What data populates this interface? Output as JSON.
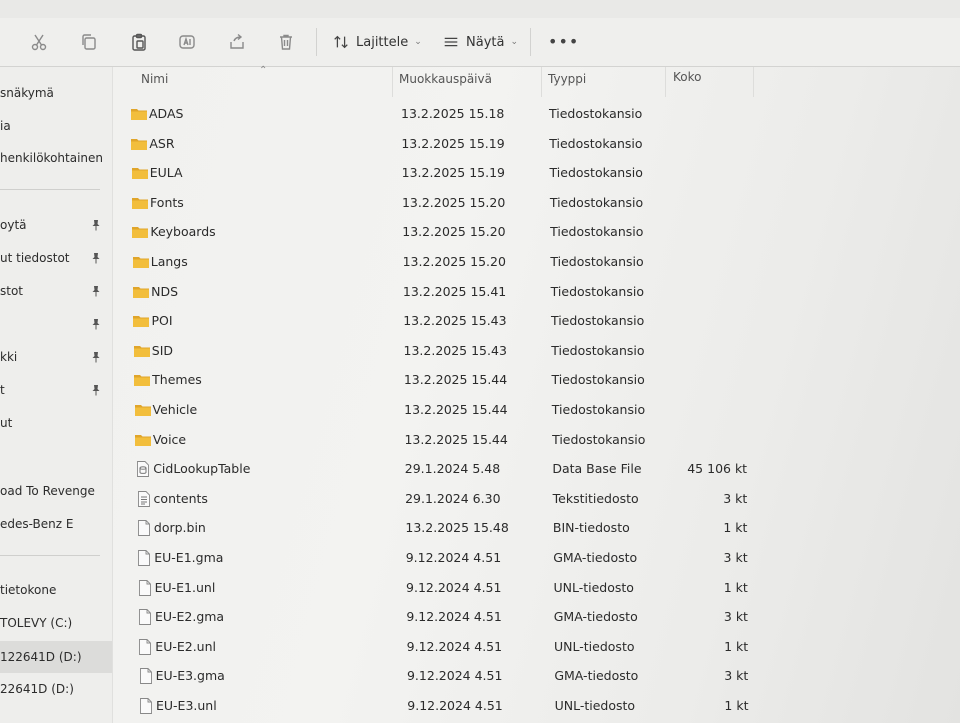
{
  "toolbar": {
    "sort_label": "Lajittele",
    "view_label": "Näytä",
    "more_label": "•••"
  },
  "sidebar": {
    "items": [
      {
        "label": "snäkymä",
        "pinned": false
      },
      {
        "label": "ia",
        "pinned": false
      },
      {
        "label": "henkilökohtainen",
        "pinned": false
      },
      {
        "label": "oytä",
        "pinned": true
      },
      {
        "label": "ut tiedostot",
        "pinned": true
      },
      {
        "label": "stot",
        "pinned": true
      },
      {
        "label": "",
        "pinned": true
      },
      {
        "label": "kki",
        "pinned": true
      },
      {
        "label": "t",
        "pinned": true
      },
      {
        "label": "ut",
        "pinned": false
      },
      {
        "label": "oad To Revenge",
        "pinned": false
      },
      {
        "label": "edes-Benz E",
        "pinned": false
      },
      {
        "label": "tietokone",
        "pinned": false
      },
      {
        "label": "TOLEVY (C:)",
        "pinned": false
      },
      {
        "label": "122641D (D:)",
        "pinned": false,
        "selected": true
      },
      {
        "label": "22641D (D:)",
        "pinned": false
      }
    ]
  },
  "columns": {
    "name": "Nimi",
    "modified": "Muokkauspäivä",
    "type": "Tyyppi",
    "size": "Koko"
  },
  "files": [
    {
      "name": "ADAS",
      "modified": "13.2.2025 15.18",
      "type": "Tiedostokansio",
      "size": "",
      "icon": "folder"
    },
    {
      "name": "ASR",
      "modified": "13.2.2025 15.19",
      "type": "Tiedostokansio",
      "size": "",
      "icon": "folder"
    },
    {
      "name": "EULA",
      "modified": "13.2.2025 15.19",
      "type": "Tiedostokansio",
      "size": "",
      "icon": "folder"
    },
    {
      "name": "Fonts",
      "modified": "13.2.2025 15.20",
      "type": "Tiedostokansio",
      "size": "",
      "icon": "folder"
    },
    {
      "name": "Keyboards",
      "modified": "13.2.2025 15.20",
      "type": "Tiedostokansio",
      "size": "",
      "icon": "folder"
    },
    {
      "name": "Langs",
      "modified": "13.2.2025 15.20",
      "type": "Tiedostokansio",
      "size": "",
      "icon": "folder"
    },
    {
      "name": "NDS",
      "modified": "13.2.2025 15.41",
      "type": "Tiedostokansio",
      "size": "",
      "icon": "folder"
    },
    {
      "name": "POI",
      "modified": "13.2.2025 15.43",
      "type": "Tiedostokansio",
      "size": "",
      "icon": "folder"
    },
    {
      "name": "SID",
      "modified": "13.2.2025 15.43",
      "type": "Tiedostokansio",
      "size": "",
      "icon": "folder"
    },
    {
      "name": "Themes",
      "modified": "13.2.2025 15.44",
      "type": "Tiedostokansio",
      "size": "",
      "icon": "folder"
    },
    {
      "name": "Vehicle",
      "modified": "13.2.2025 15.44",
      "type": "Tiedostokansio",
      "size": "",
      "icon": "folder"
    },
    {
      "name": "Voice",
      "modified": "13.2.2025 15.44",
      "type": "Tiedostokansio",
      "size": "",
      "icon": "folder"
    },
    {
      "name": "CidLookupTable",
      "modified": "29.1.2024 5.48",
      "type": "Data Base File",
      "size": "45 106 kt",
      "icon": "database"
    },
    {
      "name": "contents",
      "modified": "29.1.2024 6.30",
      "type": "Tekstitiedosto",
      "size": "3 kt",
      "icon": "text"
    },
    {
      "name": "dorp.bin",
      "modified": "13.2.2025 15.48",
      "type": "BIN-tiedosto",
      "size": "1 kt",
      "icon": "file"
    },
    {
      "name": "EU-E1.gma",
      "modified": "9.12.2024 4.51",
      "type": "GMA-tiedosto",
      "size": "3 kt",
      "icon": "file"
    },
    {
      "name": "EU-E1.unl",
      "modified": "9.12.2024 4.51",
      "type": "UNL-tiedosto",
      "size": "1 kt",
      "icon": "file"
    },
    {
      "name": "EU-E2.gma",
      "modified": "9.12.2024 4.51",
      "type": "GMA-tiedosto",
      "size": "3 kt",
      "icon": "file"
    },
    {
      "name": "EU-E2.unl",
      "modified": "9.12.2024 4.51",
      "type": "UNL-tiedosto",
      "size": "1 kt",
      "icon": "file"
    },
    {
      "name": "EU-E3.gma",
      "modified": "9.12.2024 4.51",
      "type": "GMA-tiedosto",
      "size": "3 kt",
      "icon": "file"
    },
    {
      "name": "EU-E3.unl",
      "modified": "9.12.2024 4.51",
      "type": "UNL-tiedosto",
      "size": "1 kt",
      "icon": "file"
    }
  ],
  "colors": {
    "folder": "#f2be3c",
    "folder_dark": "#e0a52a",
    "accent_selected": "#dcdcda"
  }
}
